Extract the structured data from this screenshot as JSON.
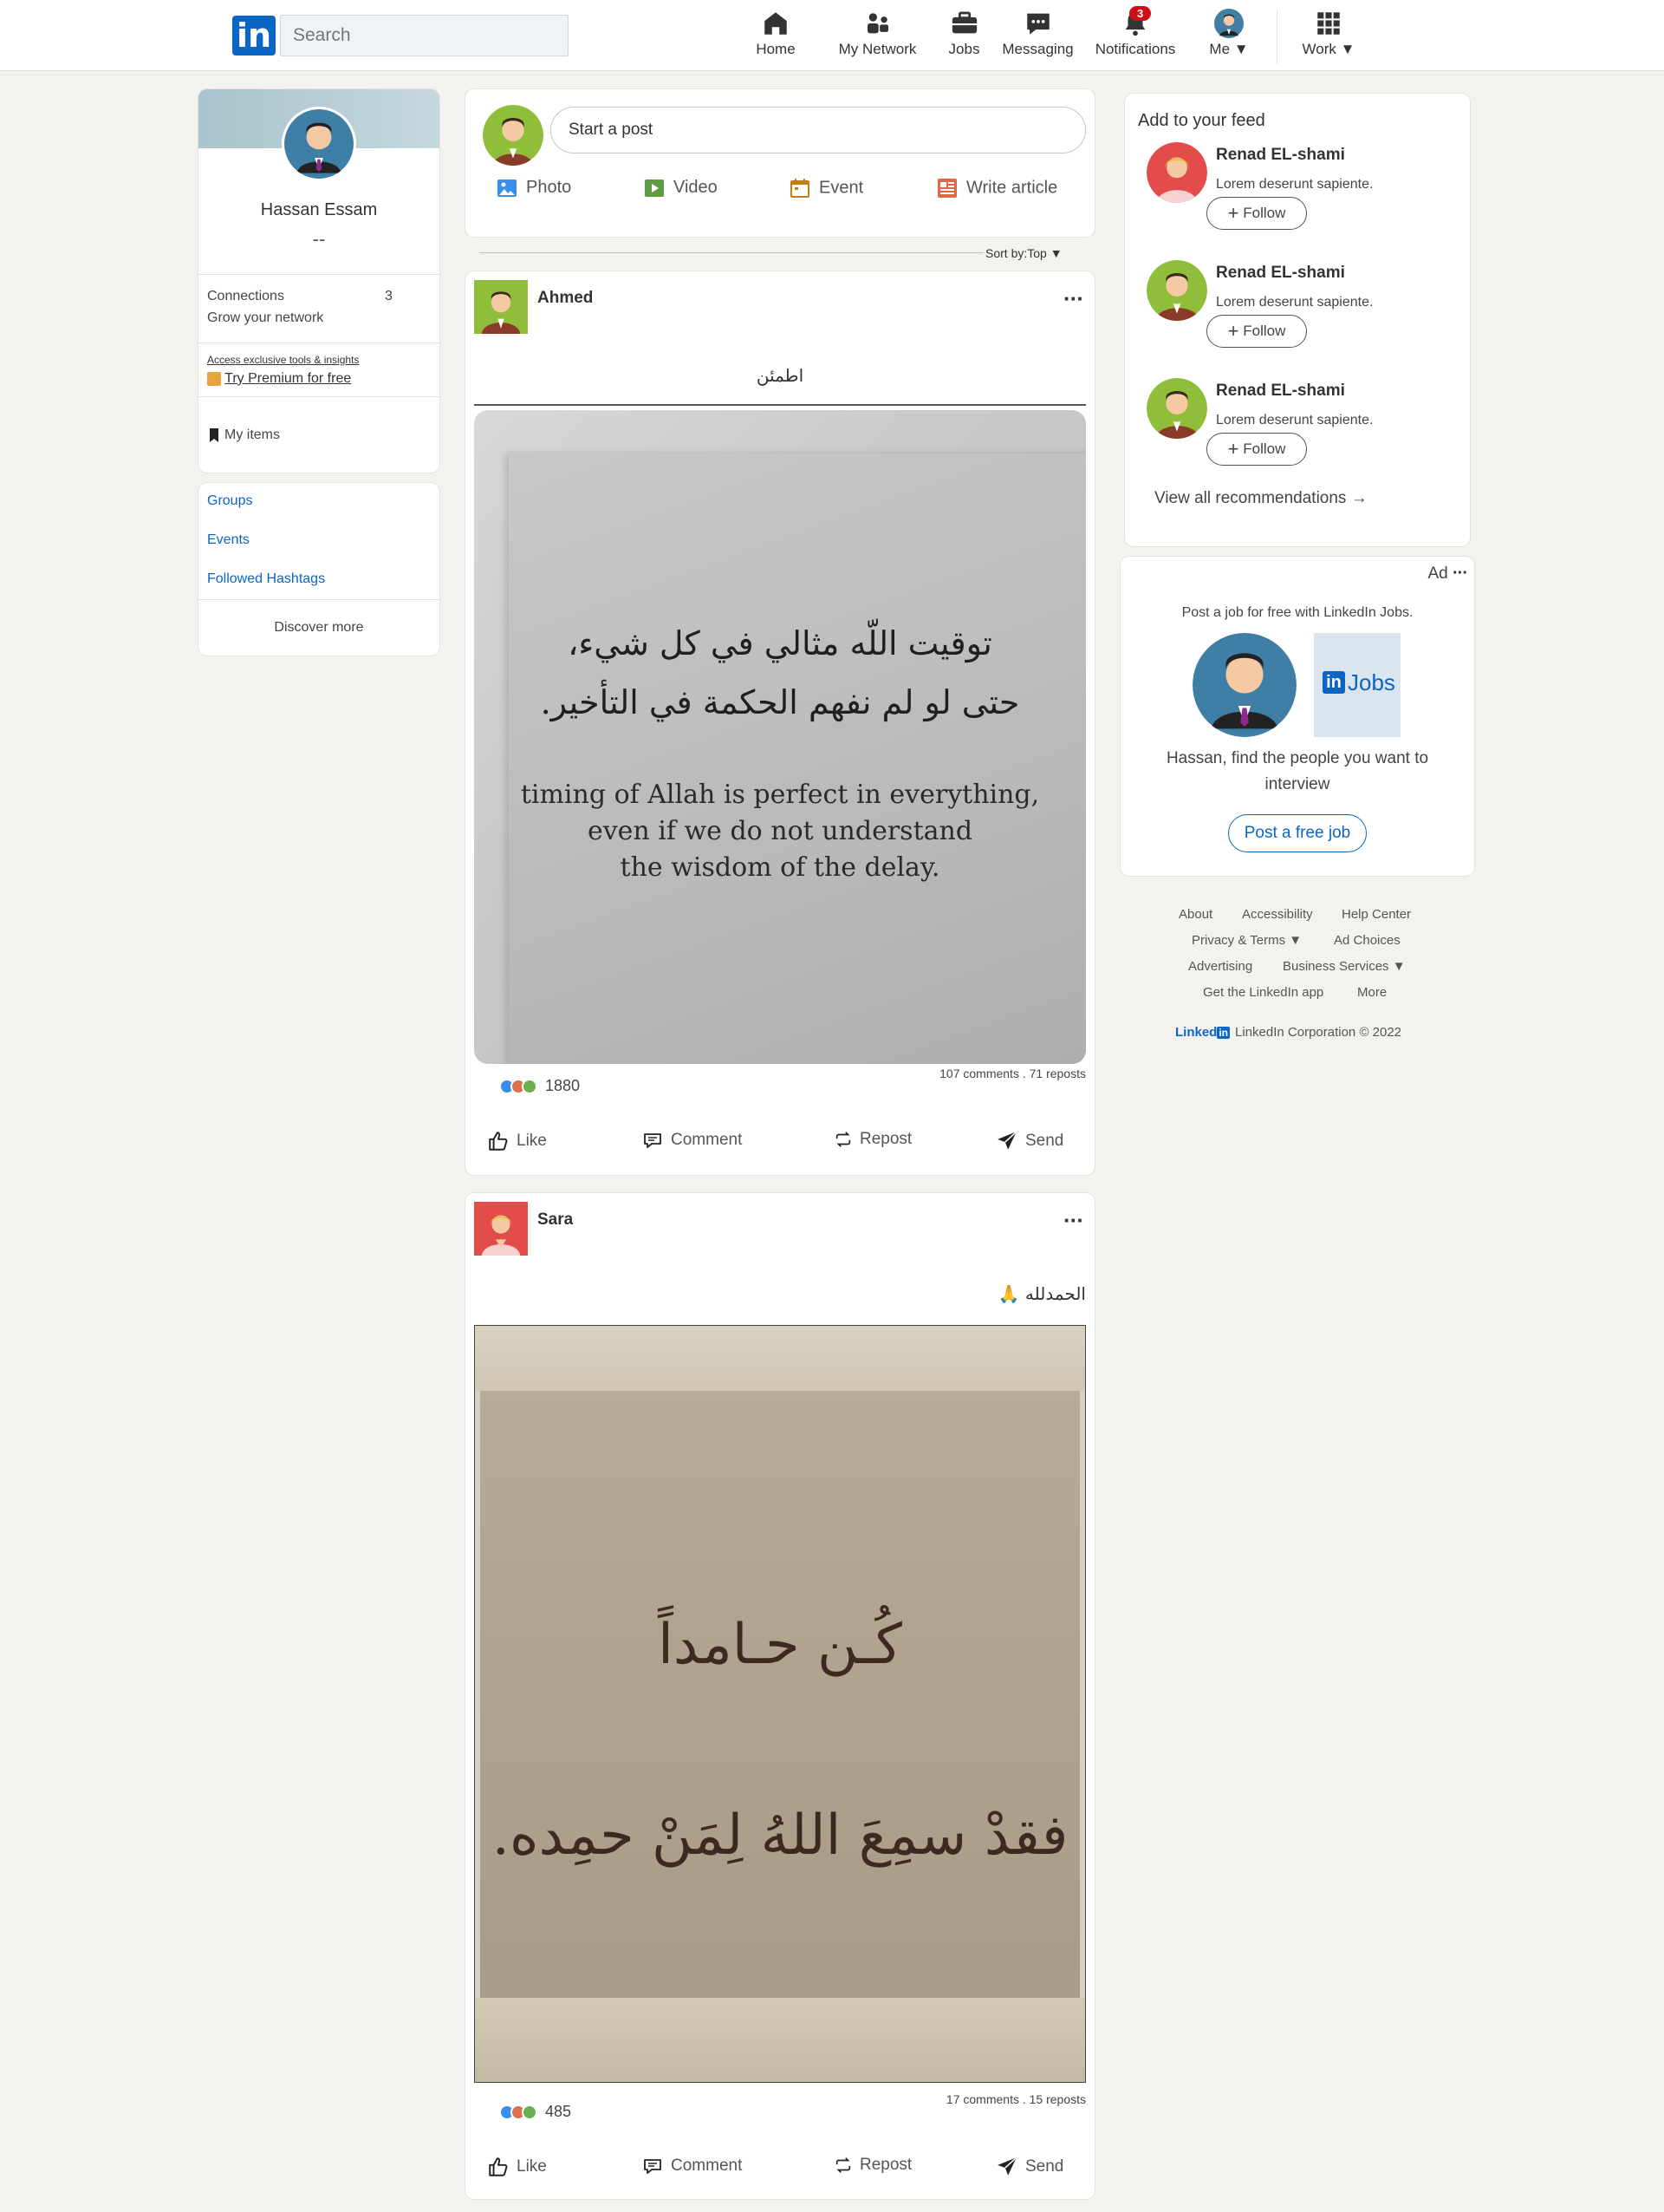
{
  "nav": {
    "search_placeholder": "Search",
    "items": [
      {
        "label": "Home",
        "icon": "home-icon"
      },
      {
        "label": "My Network",
        "icon": "network-icon"
      },
      {
        "label": "Jobs",
        "icon": "briefcase-icon"
      },
      {
        "label": "Messaging",
        "icon": "messaging-icon"
      },
      {
        "label": "Notifications",
        "icon": "bell-icon",
        "badge": "3"
      },
      {
        "label": "Me",
        "icon": "avatar"
      },
      {
        "label": "Work",
        "icon": "grid-icon"
      }
    ]
  },
  "profile": {
    "name": "Hassan Essam",
    "headline": "--",
    "connections_label": "Connections",
    "connections_count": "3",
    "grow_label": "Grow your network",
    "premium_small": "Access exclusive tools & insights",
    "premium_link": "Try Premium for free",
    "my_items": "My items"
  },
  "left_links": {
    "groups": "Groups",
    "events": "Events",
    "hashtags": "Followed Hashtags",
    "discover": "Discover more"
  },
  "composer": {
    "placeholder": "Start a post",
    "photo": "Photo",
    "video": "Video",
    "event": "Event",
    "article": "Write article"
  },
  "sort": "Sort by:Top",
  "posts": [
    {
      "author": "Ahmed",
      "text": "اطمئن",
      "image_lines_ar": [
        "توقيت اللّه مثالي في كل شيء،",
        "حتى لو لم نفهم الحكمة في التأخير."
      ],
      "image_lines_en": [
        "timing of Allah is perfect in everything,",
        "even if we do not understand",
        "the wisdom of the delay."
      ],
      "reactions": "1880",
      "stats": "107 comments . 71 reposts"
    },
    {
      "author": "Sara",
      "text": "الحمدلله 🙏",
      "image_lines_ar": [
        "كُـن حـامداً",
        "فقدْ سمِعَ اللهُ لِمَنْ حمِده."
      ],
      "reactions": "485",
      "stats": "17 comments . 15 reposts"
    }
  ],
  "actions": {
    "like": "Like",
    "comment": "Comment",
    "repost": "Repost",
    "send": "Send"
  },
  "feed": {
    "title": "Add to your feed",
    "recs": [
      {
        "name": "Renad EL-shami",
        "desc": "Lorem deserunt sapiente.",
        "follow": "Follow"
      },
      {
        "name": "Renad EL-shami",
        "desc": "Lorem deserunt sapiente.",
        "follow": "Follow"
      },
      {
        "name": "Renad EL-shami",
        "desc": "Lorem deserunt sapiente.",
        "follow": "Follow"
      }
    ],
    "view_all": "View all recommendations"
  },
  "ad": {
    "label": "Ad",
    "tagline": "Post a job for free with LinkedIn Jobs.",
    "jobs_logo_text": "Jobs",
    "message": "Hassan, find the people you want to interview",
    "cta": "Post a free job"
  },
  "footer": {
    "row1": [
      "About",
      "Accessibility",
      "Help Center"
    ],
    "row2": [
      "Privacy & Terms",
      "Ad Choices"
    ],
    "row3": [
      "Advertising",
      "Business Services"
    ],
    "row4": [
      "Get the LinkedIn app",
      "More"
    ],
    "brand_text": "Linked",
    "copyright": "LinkedIn Corporation © 2022"
  },
  "colors": {
    "brand": "#0a66c2",
    "badge": "#cc1016",
    "background": "#f3f2ef"
  }
}
